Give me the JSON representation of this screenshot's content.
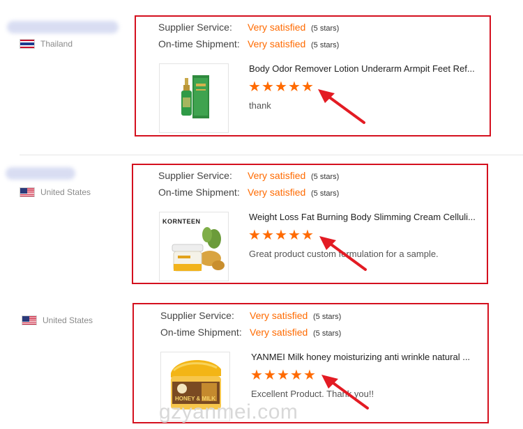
{
  "labels": {
    "supplier_service": "Supplier Service:",
    "on_time_shipment": "On-time Shipment:"
  },
  "reviews": [
    {
      "country": "Thailand",
      "supplier_service": {
        "value": "Very satisfied",
        "stars_text": "(5 stars)"
      },
      "on_time_shipment": {
        "value": "Very satisfied",
        "stars_text": "(5 stars)"
      },
      "product_title": "Body Odor Remover Lotion Underarm Armpit Feet Ref...",
      "rating": 5,
      "comment": "thank"
    },
    {
      "country": "United States",
      "supplier_service": {
        "value": "Very satisfied",
        "stars_text": "(5 stars)"
      },
      "on_time_shipment": {
        "value": "Very satisfied",
        "stars_text": "(5 stars)"
      },
      "product_title": "Weight Loss Fat Burning Body Slimming Cream Celluli...",
      "product_brand": "KORNTEEN",
      "rating": 5,
      "comment": "Great product custom formulation for a sample."
    },
    {
      "country": "United States",
      "supplier_service": {
        "value": "Very satisfied",
        "stars_text": "(5 stars)"
      },
      "on_time_shipment": {
        "value": "Very satisfied",
        "stars_text": "(5 stars)"
      },
      "product_title": "YANMEI Milk honey moisturizing anti wrinkle natural ...",
      "product_label": "HONEY & MILK",
      "rating": 5,
      "comment": "Excellent Product.  Thank you!!"
    }
  ],
  "watermark": "gzyanmei.com",
  "colors": {
    "highlight_box": "#d4101e",
    "accent_orange": "#ff6a00",
    "arrow_red": "#e31b23"
  }
}
